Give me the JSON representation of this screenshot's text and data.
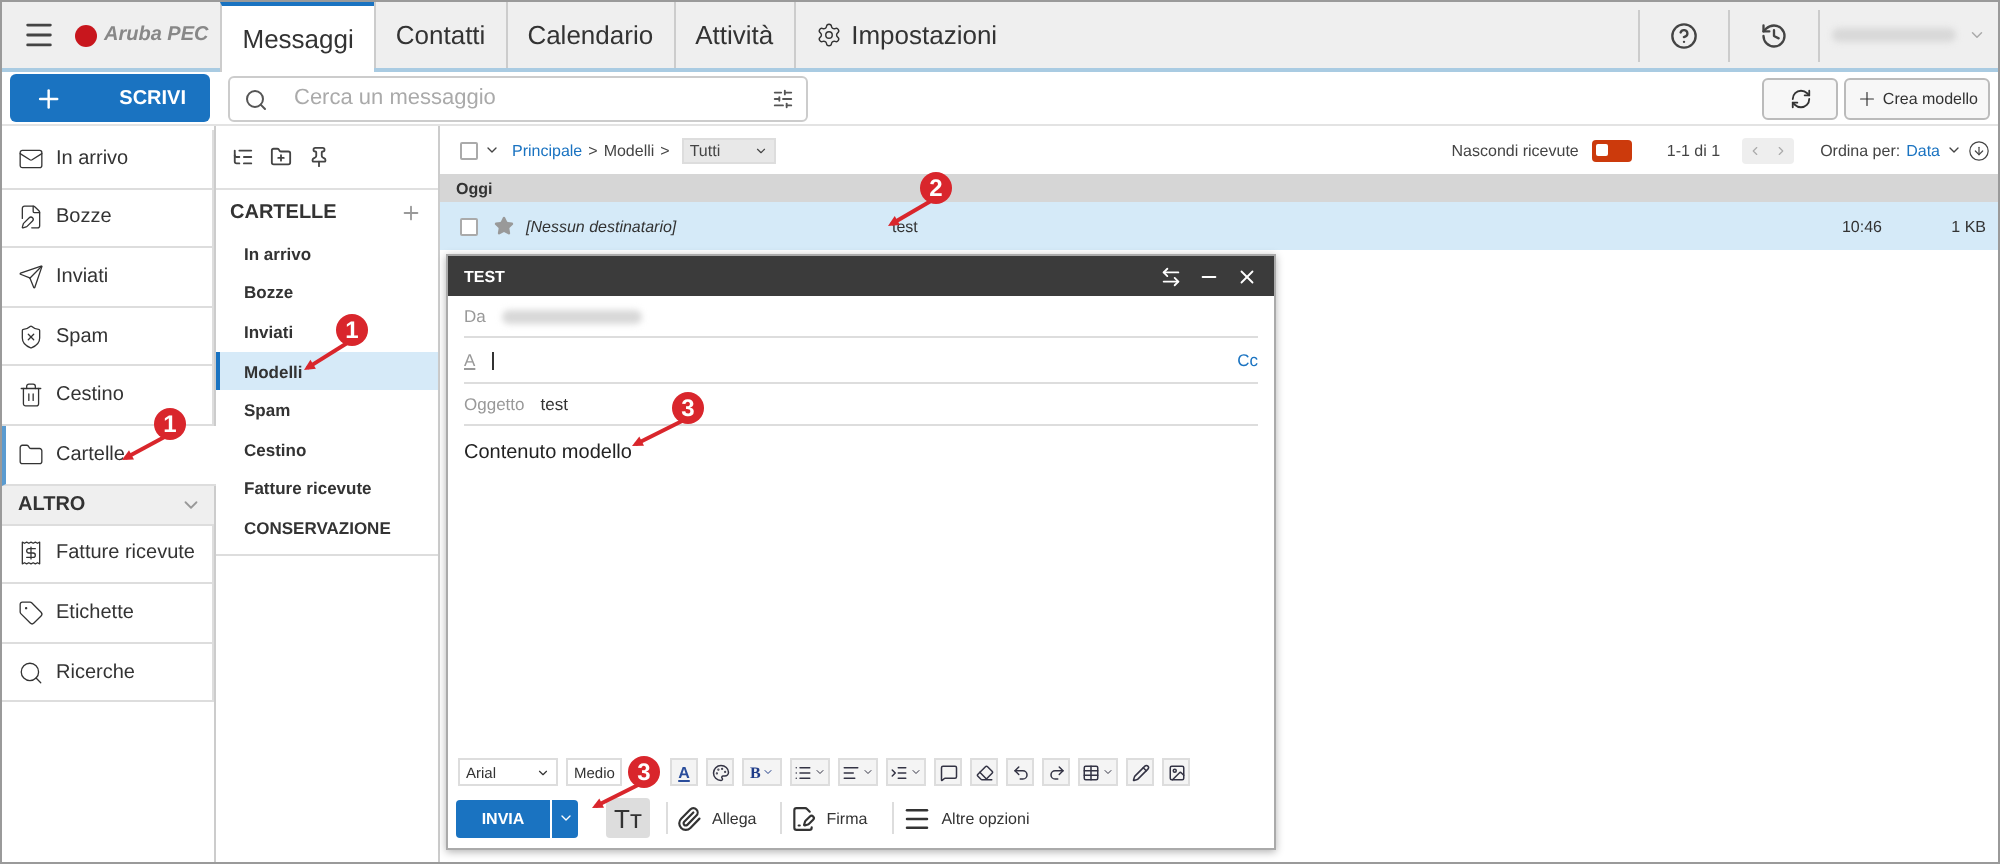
{
  "topbar": {
    "logo": "Aruba PEC",
    "tabs": [
      {
        "label": "Messaggi",
        "selected": true,
        "kind": "text"
      },
      {
        "label": "Contatti",
        "selected": false,
        "kind": "text"
      },
      {
        "label": "Calendario",
        "selected": false,
        "kind": "text"
      },
      {
        "label": "Attività",
        "selected": false,
        "kind": "text"
      },
      {
        "label": "Impostazioni",
        "selected": false,
        "kind": "settings"
      }
    ]
  },
  "compose_button": "SCRIVI",
  "search": {
    "placeholder": "Cerca un messaggio"
  },
  "new_template_button": "Crea modello",
  "nav": {
    "items": [
      {
        "label": "In arrivo",
        "selected": false
      },
      {
        "label": "Bozze",
        "selected": false
      },
      {
        "label": "Inviati",
        "selected": false
      },
      {
        "label": "Spam",
        "selected": false
      },
      {
        "label": "Cestino",
        "selected": false
      },
      {
        "label": "Cartelle",
        "selected": true,
        "callout": "1"
      }
    ],
    "section": {
      "title": "ALTRO",
      "expanded": true,
      "items": [
        {
          "label": "Fatture ricevute",
          "selected": false
        },
        {
          "label": "Etichette",
          "selected": false
        },
        {
          "label": "Ricerche",
          "selected": false
        }
      ]
    }
  },
  "folders": {
    "title": "CARTELLE",
    "items": [
      {
        "label": "In arrivo",
        "selected": false
      },
      {
        "label": "Bozze",
        "selected": false
      },
      {
        "label": "Inviati",
        "selected": false
      },
      {
        "label": "Modelli",
        "selected": true,
        "callout": "1"
      },
      {
        "label": "Spam",
        "selected": false
      },
      {
        "label": "Cestino",
        "selected": false
      },
      {
        "label": "Fatture ricevute",
        "selected": false
      },
      {
        "label": "CONSERVAZIONE",
        "selected": false
      }
    ]
  },
  "message_list": {
    "select_all_checked": false,
    "breadcrumb": {
      "items": [
        "Principale",
        "Modelli"
      ],
      "separator": ">"
    },
    "filter": "Tutti",
    "hide_received": {
      "label": "Nascondi ricevute",
      "on": false
    },
    "range": "1-1 di 1",
    "sort": {
      "label": "Ordina per:",
      "value": "Data"
    },
    "groups": [
      {
        "title": "Oggi",
        "rows": [
          {
            "recipient": "[Nessun destinatario]",
            "subject": "test",
            "time": "10:46",
            "size": "1 KB",
            "selected": true,
            "checked": false,
            "starred": false,
            "callout": "2"
          }
        ]
      }
    ]
  },
  "compose": {
    "title": "TEST",
    "from_label": "Da",
    "to_label": "A",
    "cc": "Cc",
    "subject_label": "Oggetto",
    "subject": "test",
    "body": "Contenuto modello",
    "body_callout": "3",
    "toolbar": {
      "font": "Arial",
      "size": "Medio",
      "text_color_label": "A",
      "bold_label": "B"
    },
    "send": "INVIA",
    "send_callout": "3",
    "format_label": "Tт",
    "attach": "Allega",
    "signature": "Firma",
    "more": "Altre opzioni"
  }
}
